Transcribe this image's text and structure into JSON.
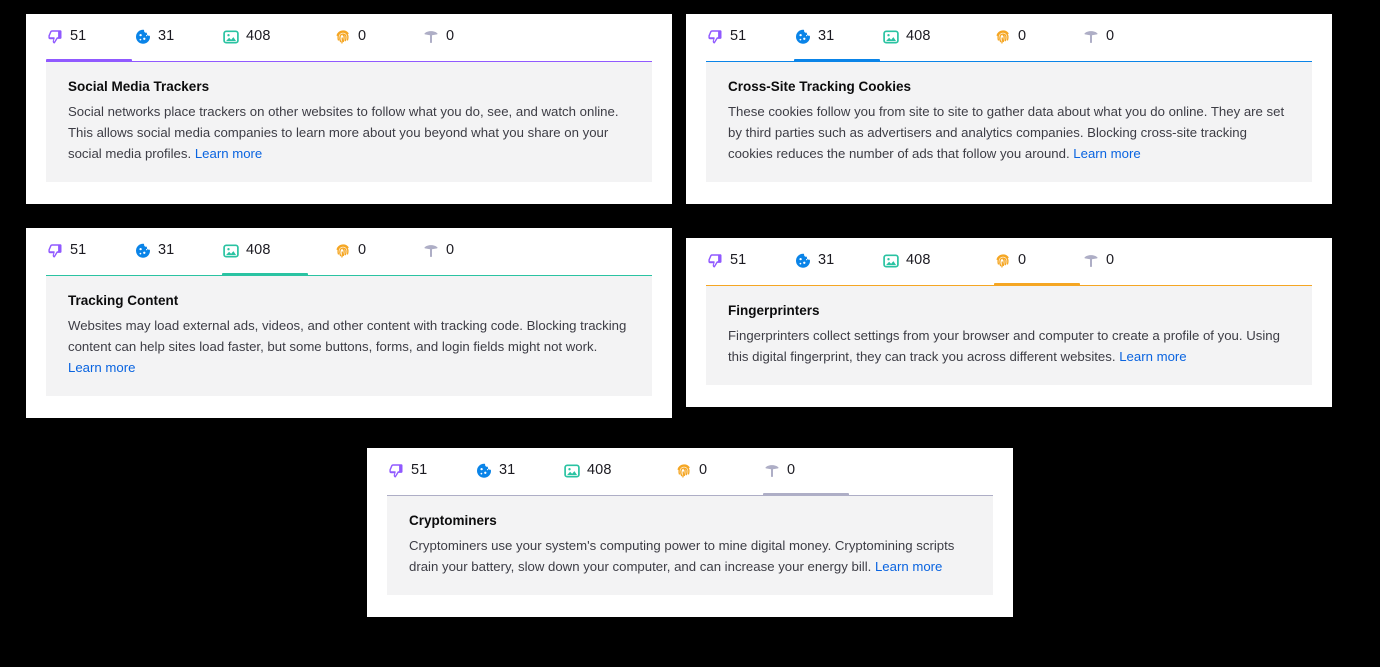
{
  "meta": {
    "colors": {
      "social": "#9059ff",
      "cookie": "#0a84e8",
      "content": "#2ac3a2",
      "fingerprint": "#f5a623",
      "cryptominer": "#aeaec6",
      "link": "#0a64e0",
      "panel_bg": "#f3f3f4",
      "card_bg": "#ffffff",
      "page_bg": "#000000"
    }
  },
  "tabs": [
    {
      "key": "social",
      "icon": "thumbs-down-icon",
      "label": "Social Media Trackers",
      "count": "51",
      "color": "#9059ff"
    },
    {
      "key": "cookie",
      "icon": "cookie-icon",
      "label": "Cross-Site Tracking Cookies",
      "count": "31",
      "color": "#0a84e8"
    },
    {
      "key": "content",
      "icon": "image-icon",
      "label": "Tracking Content",
      "count": "408",
      "color": "#2ac3a2"
    },
    {
      "key": "fingerprint",
      "icon": "fingerprint-icon",
      "label": "Fingerprinters",
      "count": "0",
      "color": "#f5a623"
    },
    {
      "key": "cryptominer",
      "icon": "pickaxe-icon",
      "label": "Cryptominers",
      "count": "0",
      "color": "#aeaec6"
    }
  ],
  "cards": [
    {
      "active": "social",
      "title": "Social Media Trackers",
      "desc_before": "Social networks place trackers on other websites to follow what you do, see, and watch online. This allows social media companies to learn more about you beyond what you share on your social media profiles. ",
      "link": "Learn more"
    },
    {
      "active": "cookie",
      "title": "Cross-Site Tracking Cookies",
      "desc_before": "These cookies follow you from site to site to gather data about what you do online. They are set by third parties such as advertisers and analytics companies. Blocking cross-site tracking cookies reduces the number of ads that follow you around. ",
      "link": "Learn more"
    },
    {
      "active": "content",
      "title": "Tracking Content",
      "desc_before": "Websites may load external ads, videos, and other content with tracking code. Blocking tracking content can help sites load faster, but some buttons, forms, and login fields might not work. ",
      "link": "Learn more"
    },
    {
      "active": "fingerprint",
      "title": "Fingerprinters",
      "desc_before": "Fingerprinters collect settings from your browser and computer to create a profile of you. Using this digital fingerprint, they can track you across different websites. ",
      "link": "Learn more"
    },
    {
      "active": "cryptominer",
      "title": "Cryptominers",
      "desc_before": "Cryptominers use your system's computing power to mine digital money. Cryptomining scripts drain your battery, slow down your computer, and can increase your energy bill. ",
      "link": "Learn more"
    }
  ]
}
